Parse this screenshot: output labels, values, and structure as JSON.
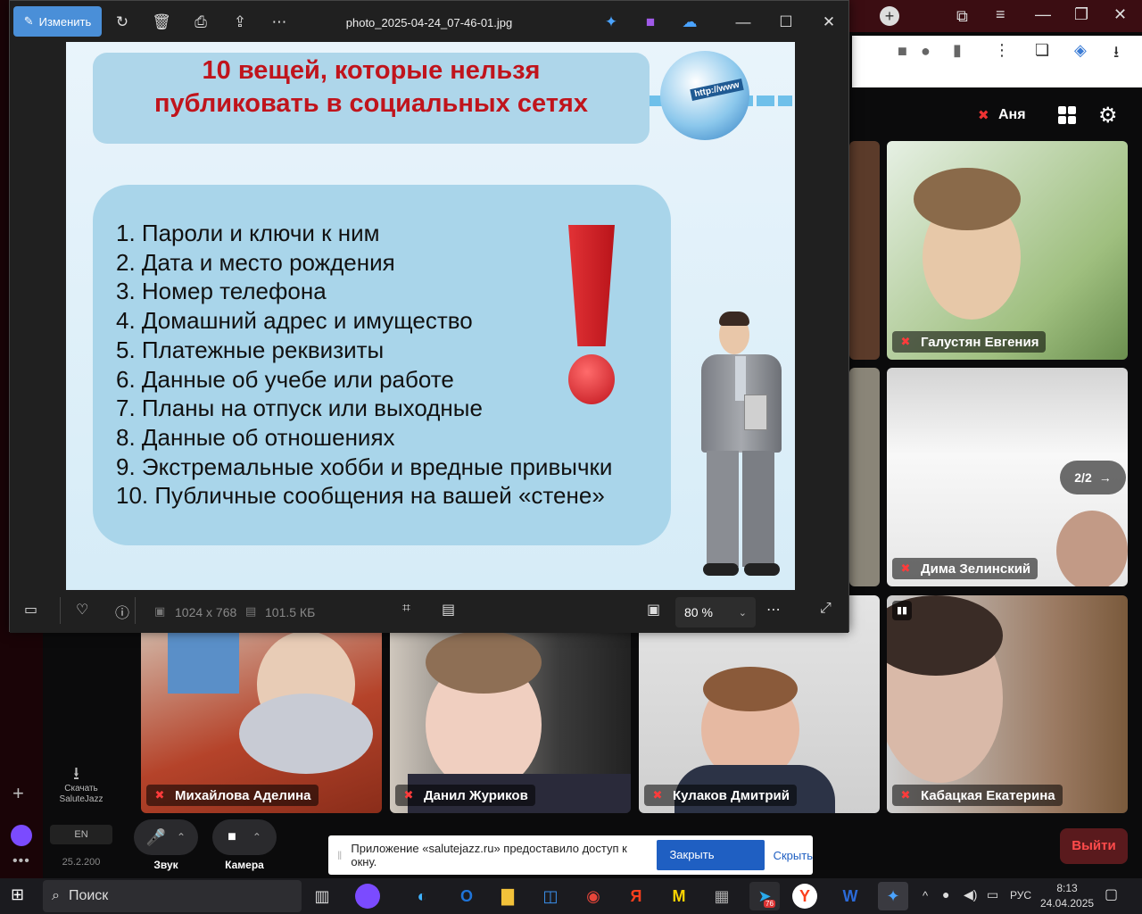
{
  "viewer": {
    "title": "photo_2025-04-24_07-46-01.jpg",
    "edit_label": "Изменить",
    "dimensions": "1024 x 768",
    "file_size": "101.5 КБ",
    "zoom": "80 %"
  },
  "slide": {
    "title_line1": "10 вещей, которые нельзя",
    "title_line2": "публиковать в социальных сетях",
    "globe_text": "http://www",
    "items": [
      "1.  Пароли и ключи к ним",
      "2.  Дата и место рождения",
      "3.  Номер телефона",
      "4.  Домашний адрес и имущество",
      "5.  Платежные реквизиты",
      "6.  Данные об учебе или работе",
      "7.  Планы на отпуск или выходные",
      "8.  Данные об отношениях",
      "9.  Экстремальные хобби и вредные привычки",
      "10. Публичные сообщения на вашей «стене»"
    ]
  },
  "meeting": {
    "user_name": "Аня",
    "pager": "2/2",
    "participants": {
      "galustyan": "Галустян Евгения",
      "dima": "Дима Зелинский",
      "mikhailova": "Михайлова Аделина",
      "zhurikov": "Данил Журиков",
      "kulakov": "Кулаков Дмитрий",
      "kabatskaya": "Кабацкая Екатерина"
    },
    "download_label_1": "Скачать",
    "download_label_2": "SaluteJazz",
    "lang": "EN",
    "version": "25.2.200",
    "mic_label": "Звук",
    "cam_label": "Камера",
    "exit_label": "Выйти"
  },
  "notification": {
    "text": "Приложение «salutejazz.ru» предоставило доступ к окну.",
    "close_access": "Закрыть доступ",
    "hide": "Скрыть"
  },
  "taskbar": {
    "search": "Поиск",
    "lang": "РУС",
    "time": "8:13",
    "date": "24.04.2025",
    "telegram_badge": "76"
  },
  "colors": {
    "accent": "#4a8fd8",
    "title_red": "#c0141c",
    "exit_red": "#5a1a1d"
  }
}
